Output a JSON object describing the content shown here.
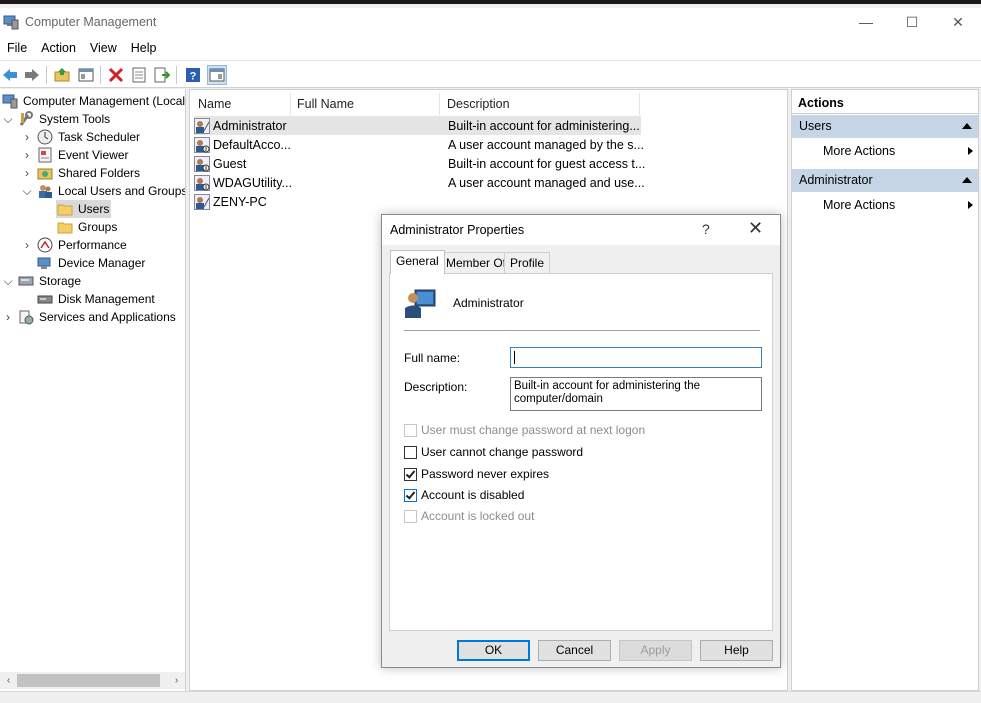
{
  "window": {
    "title": "Computer Management",
    "controls": {
      "minimize": "—",
      "maximize": "☐",
      "close": "✕"
    }
  },
  "menu": [
    "File",
    "Action",
    "View",
    "Help"
  ],
  "tree": {
    "items": [
      {
        "label": "Computer Management (Local",
        "icon": "computer-management-icon",
        "chevron": ""
      },
      {
        "label": "System Tools",
        "icon": "system-tools-icon",
        "chevron": "expanded"
      },
      {
        "label": "Task Scheduler",
        "icon": "clock-icon",
        "chevron": "collapsed"
      },
      {
        "label": "Event Viewer",
        "icon": "event-viewer-icon",
        "chevron": "collapsed"
      },
      {
        "label": "Shared Folders",
        "icon": "shared-folder-icon",
        "chevron": "collapsed"
      },
      {
        "label": "Local Users and Groups",
        "icon": "users-groups-icon",
        "chevron": "expanded"
      },
      {
        "label": "Users",
        "icon": "folder-icon",
        "chevron": ""
      },
      {
        "label": "Groups",
        "icon": "folder-icon",
        "chevron": ""
      },
      {
        "label": "Performance",
        "icon": "performance-icon",
        "chevron": "collapsed"
      },
      {
        "label": "Device Manager",
        "icon": "device-manager-icon",
        "chevron": ""
      },
      {
        "label": "Storage",
        "icon": "storage-icon",
        "chevron": "expanded"
      },
      {
        "label": "Disk Management",
        "icon": "disk-icon",
        "chevron": ""
      },
      {
        "label": "Services and Applications",
        "icon": "services-icon",
        "chevron": "collapsed"
      }
    ]
  },
  "list": {
    "columns": [
      "Name",
      "Full Name",
      "Description"
    ],
    "rows": [
      {
        "name": "Administrator",
        "full_name": "",
        "description": "Built-in account for administering..."
      },
      {
        "name": "DefaultAcco...",
        "full_name": "",
        "description": "A user account managed by the s..."
      },
      {
        "name": "Guest",
        "full_name": "",
        "description": "Built-in account for guest access t..."
      },
      {
        "name": "WDAGUtility...",
        "full_name": "",
        "description": "A user account managed and use..."
      },
      {
        "name": "ZENY-PC",
        "full_name": "",
        "description": ""
      }
    ]
  },
  "actions": {
    "title": "Actions",
    "sections": [
      {
        "label": "Users",
        "link": "More Actions"
      },
      {
        "label": "Administrator",
        "link": "More Actions"
      }
    ]
  },
  "dialog": {
    "title": "Administrator Properties",
    "help_glyph": "?",
    "close_glyph": "✕",
    "tabs": [
      "General",
      "Member Of",
      "Profile"
    ],
    "user_name": "Administrator",
    "full_name_label": "Full name:",
    "full_name_value": "",
    "description_label": "Description:",
    "description_value": "Built-in account for administering the computer/domain",
    "checkboxes": [
      {
        "label": "User must change password at next logon",
        "checked": false,
        "disabled": true
      },
      {
        "label": "User cannot change password",
        "checked": false,
        "disabled": false
      },
      {
        "label": "Password never expires",
        "checked": true,
        "disabled": false
      },
      {
        "label": "Account is disabled",
        "checked": true,
        "disabled": false
      },
      {
        "label": "Account is locked out",
        "checked": false,
        "disabled": true
      }
    ],
    "buttons": {
      "ok": "OK",
      "cancel": "Cancel",
      "apply": "Apply",
      "help": "Help"
    }
  },
  "colors": {
    "accent": "#0078d7",
    "actions_section": "#c5d5e6",
    "selection": "#d9d9d9"
  }
}
